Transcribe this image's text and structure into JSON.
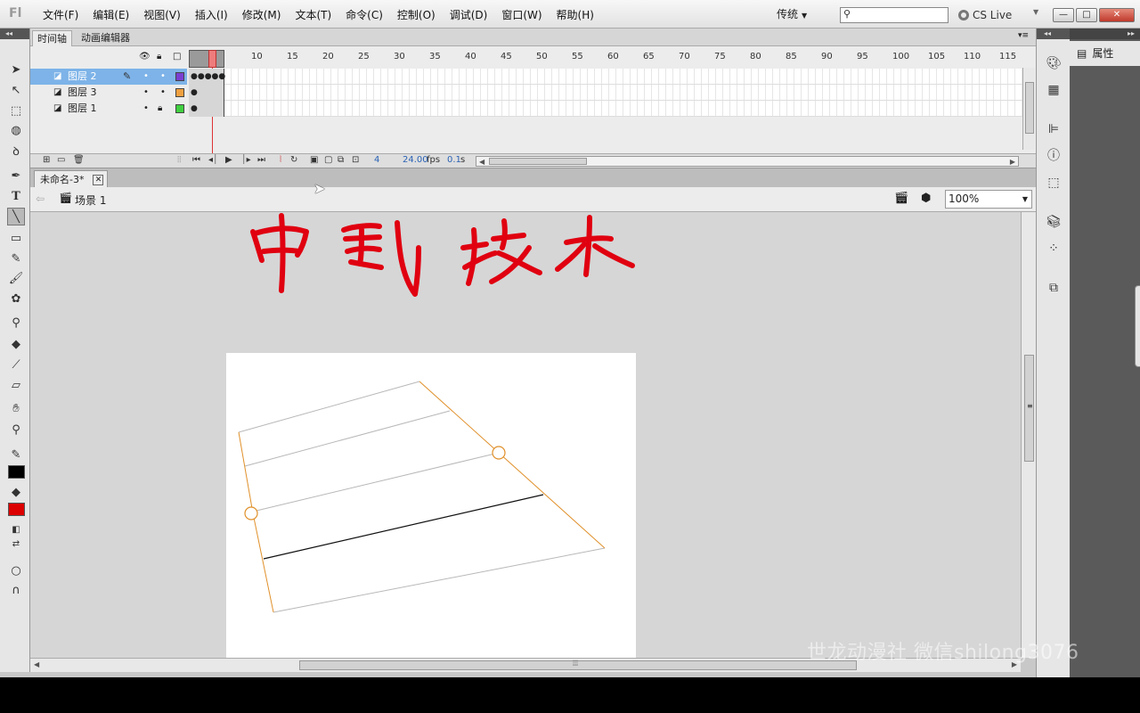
{
  "app": {
    "logo": "Fl"
  },
  "menu": [
    "文件(F)",
    "编辑(E)",
    "视图(V)",
    "插入(I)",
    "修改(M)",
    "文本(T)",
    "命令(C)",
    "控制(O)",
    "调试(D)",
    "窗口(W)",
    "帮助(H)"
  ],
  "workspace": {
    "label": "传统"
  },
  "search": {
    "placeholder": ""
  },
  "cslive": {
    "label": "CS Live"
  },
  "window_buttons": {
    "min": "—",
    "max": "□",
    "close": "✕"
  },
  "timeline": {
    "tabs": [
      "时间轴",
      "动画编辑器"
    ],
    "ruler": [
      "10",
      "15",
      "20",
      "25",
      "30",
      "35",
      "40",
      "45",
      "50",
      "55",
      "60",
      "65",
      "70",
      "75",
      "80",
      "85",
      "90",
      "95",
      "100",
      "105",
      "110",
      "115"
    ],
    "layers": [
      {
        "name": "图层 2",
        "color": "#7a3fd0",
        "selected": true,
        "locked": false
      },
      {
        "name": "图层 3",
        "color": "#f0a040",
        "selected": false,
        "locked": false
      },
      {
        "name": "图层 1",
        "color": "#40d040",
        "selected": false,
        "locked": true
      }
    ],
    "current_frame": "4",
    "fps": "24.00",
    "fps_unit": "fps",
    "time": "0.1",
    "time_unit": "s"
  },
  "document": {
    "tab": "未命名-3*",
    "scene": "场景 1",
    "zoom": "100%"
  },
  "stage": {
    "title_art": "中国技术"
  },
  "colors": {
    "stroke": "#000000",
    "fill": "#dd0000",
    "accent_red": "#e00010",
    "guide_orange": "#e0902a"
  },
  "properties": {
    "tab": "属性"
  },
  "watermark": "世龙动漫社 微信shilong3076",
  "icons": {
    "tools": [
      "selection-icon",
      "subselection-icon",
      "free-transform-icon",
      "3d-rotation-icon",
      "lasso-icon",
      "pen-icon",
      "text-icon",
      "line-icon",
      "rectangle-icon",
      "pencil-icon",
      "brush-icon",
      "deco-icon",
      "bone-icon",
      "paint-bucket-icon",
      "eyedropper-icon",
      "eraser-icon",
      "hand-icon",
      "zoom-icon"
    ]
  }
}
